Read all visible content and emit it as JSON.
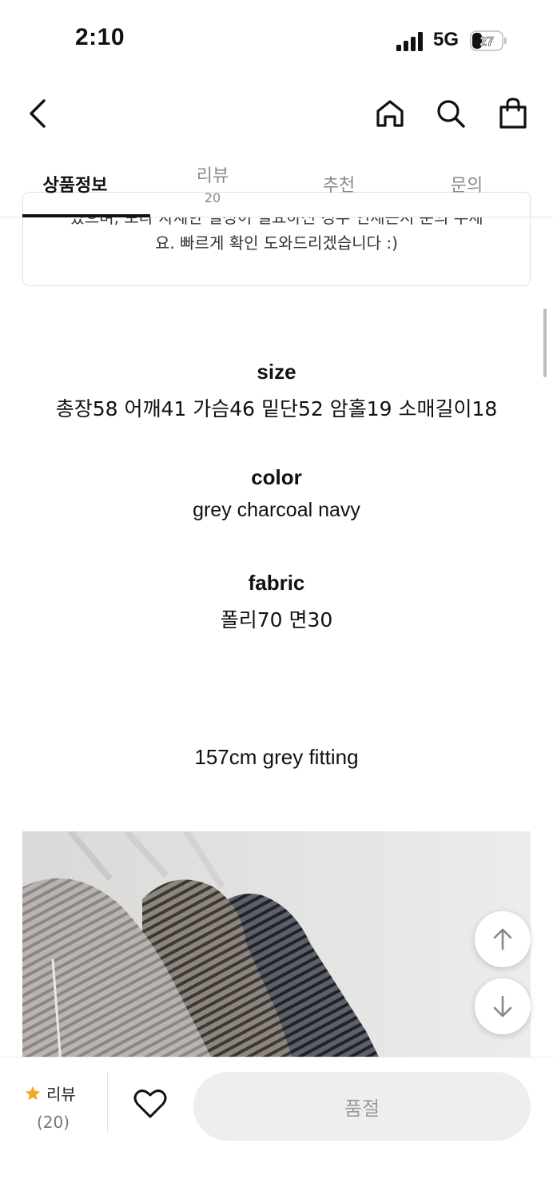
{
  "status_bar": {
    "time": "2:10",
    "network": "5G",
    "battery": "27"
  },
  "header": {
    "icons": [
      "chevron-left-icon",
      "home-icon",
      "search-icon",
      "shopping-bag-icon"
    ]
  },
  "tabs": [
    {
      "label": "상품정보",
      "active": true
    },
    {
      "label": "리뷰",
      "count": "20",
      "active": false
    },
    {
      "label": "추천",
      "active": false
    },
    {
      "label": "문의",
      "active": false
    }
  ],
  "notice": {
    "line1": "있으며, 보다 자세한 설정이 필요하신 경우 연세든지 문의 주세",
    "line2": "요. 빠르게 확인 도와드리겠습니다 :)"
  },
  "specs": {
    "size_title": "size",
    "size_value": "총장58 어깨41 가슴46 밑단52 암홀19 소매길이18",
    "color_title": "color",
    "color_value": "grey charcoal navy",
    "fabric_title": "fabric",
    "fabric_value": "폴리70 면30"
  },
  "fitting_caption": "157cm grey fitting",
  "bottom_bar": {
    "review_label": "리뷰",
    "review_count": "(20)",
    "soldout_label": "품절"
  },
  "colors": {
    "accent_star": "#f5a623",
    "soldout_bg": "#eeeeee",
    "soldout_text": "#9b9b9b"
  }
}
